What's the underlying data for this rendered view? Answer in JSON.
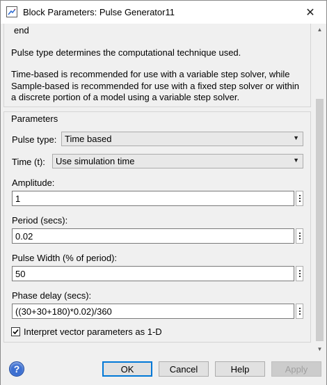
{
  "window": {
    "title": "Block Parameters: Pulse Generator11",
    "close_glyph": "✕"
  },
  "description": {
    "line_end": "end",
    "line_pulse": "Pulse type determines the computational technique used.",
    "line_time1": "Time-based is recommended for use with a variable step solver, while",
    "line_time2": "Sample-based is recommended for use with a fixed step solver or within",
    "line_time3": "a discrete portion of a model using a variable step solver."
  },
  "parameters": {
    "group_title": "Parameters",
    "pulse_type": {
      "label": "Pulse type:",
      "value": "Time based"
    },
    "time": {
      "label": "Time (t):",
      "value": "Use simulation time"
    },
    "amplitude": {
      "label": "Amplitude:",
      "value": "1"
    },
    "period": {
      "label": "Period (secs):",
      "value": "0.02"
    },
    "pulse_width": {
      "label": "Pulse Width (% of period):",
      "value": "50"
    },
    "phase_delay": {
      "label": "Phase delay (secs):",
      "value": "((30+30+180)*0.02)/360"
    },
    "interpret_vector": {
      "label": "Interpret vector parameters as 1-D",
      "checked": true
    }
  },
  "footer": {
    "help_glyph": "?",
    "ok_label": "OK",
    "cancel_label": "Cancel",
    "help_label": "Help",
    "apply_label": "Apply"
  },
  "icons": {
    "app": "simulink-block-icon",
    "dropdown": "chevron-down-icon",
    "more": "vertical-ellipsis-icon",
    "help": "question-circle-icon"
  },
  "colors": {
    "primary_border": "#0078d7",
    "help_icon": "#3c6fd1"
  }
}
